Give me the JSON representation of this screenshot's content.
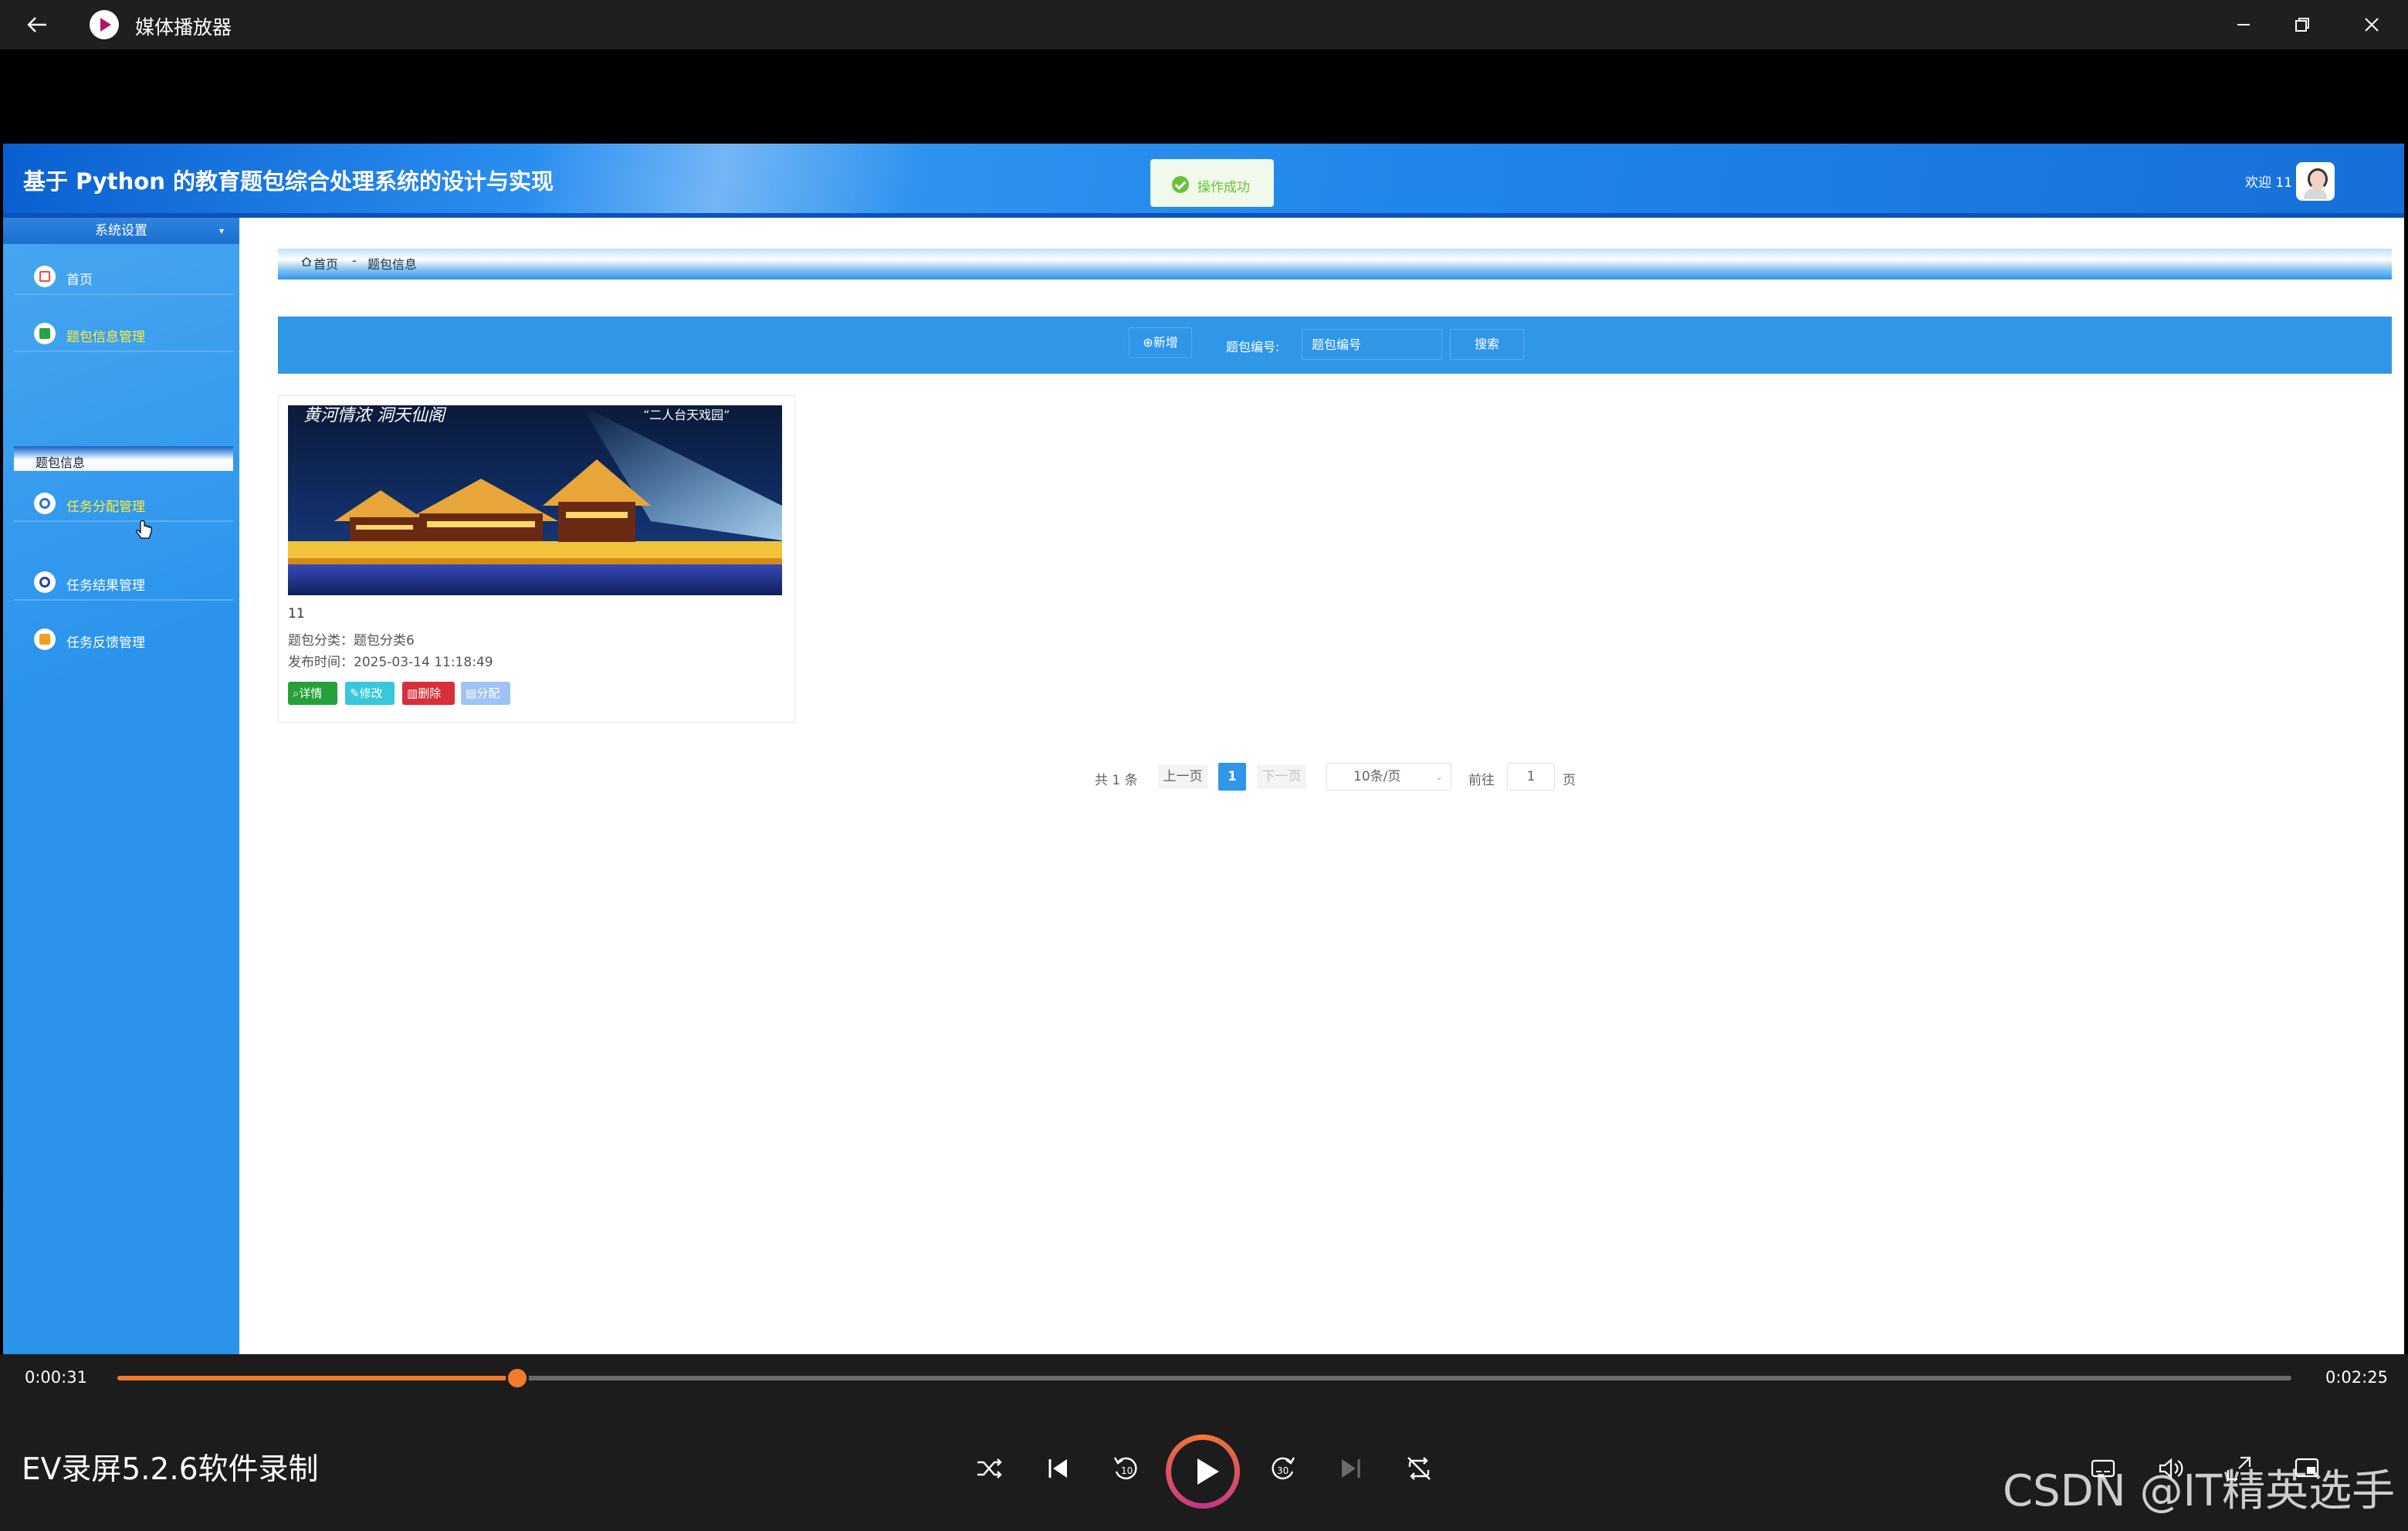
{
  "window": {
    "title": "媒体播放器"
  },
  "header": {
    "title": "基于 Python 的教育题包综合处理系统的设计与实现",
    "welcome": "欢迎 11"
  },
  "toast": {
    "message": "操作成功"
  },
  "sidebar": {
    "section_title": "系统设置",
    "group_label": "题包信息",
    "items": [
      {
        "label": "首页",
        "icon": "home-icon",
        "active": false
      },
      {
        "label": "题包信息管理",
        "icon": "square-icon",
        "active": true
      },
      {
        "label": "任务分配管理",
        "icon": "circle-icon",
        "active": true
      },
      {
        "label": "任务结果管理",
        "icon": "circle-icon",
        "active": false
      },
      {
        "label": "任务反馈管理",
        "icon": "square-icon",
        "active": false
      }
    ]
  },
  "breadcrumb": {
    "home": "首页",
    "separator": "-",
    "current": "题包信息"
  },
  "toolbar": {
    "add_label": "新增",
    "search_label": "题包编号:",
    "search_placeholder": "题包编号",
    "search_button": "搜索"
  },
  "card": {
    "name": "11",
    "category": "题包分类：题包分类6",
    "time": "发布时间：2025-03-14 11:18:49",
    "image_caption_left": "黄河情浓  洞天仙阁",
    "image_caption_right": "“二人台天戏园”",
    "actions": {
      "detail": "详情",
      "edit": "修改",
      "delete": "删除",
      "assign": "分配"
    }
  },
  "pagination": {
    "total": "共 1 条",
    "prev": "上一页",
    "current": "1",
    "next": "下一页",
    "page_size": "10条/页",
    "goto": "前往",
    "goto_value": "1",
    "page_unit": "页"
  },
  "player": {
    "current_time": "0:00:31",
    "total_time": "0:02:25",
    "progress": 0.184,
    "recording_title": "EV录屏5.2.6软件录制",
    "watermark": "CSDN @IT精英选手"
  },
  "colors": {
    "accent_blue": "#2f96e8",
    "header_blue": "#166fd8",
    "toast_green": "#67c23a",
    "player_orange": "#f07b2e",
    "active_yellow": "#ffeb3b"
  }
}
